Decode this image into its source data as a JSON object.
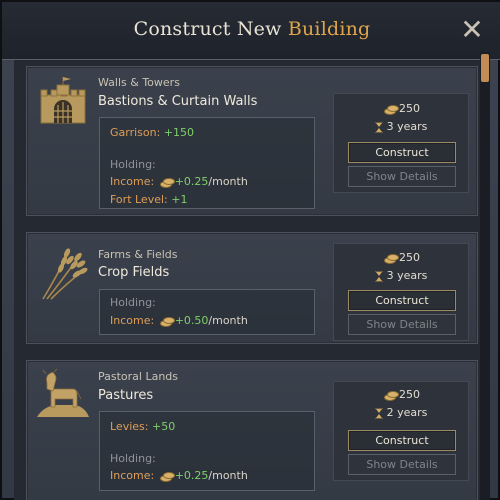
{
  "window": {
    "title_prefix": "Construct New ",
    "title_accent": "Building",
    "close_glyph": "✕"
  },
  "colors": {
    "accent": "#e0a54a",
    "positive": "#7fcf6b",
    "modifier_label": "#de9e58",
    "muted": "#8f939a"
  },
  "buildings": [
    {
      "category": "Walls & Towers",
      "name": "Bastions & Curtain Walls",
      "icon": "castle-gate-icon",
      "effects": {
        "garrison_label": "Garrison:",
        "garrison_value": "+150",
        "holding_label": "Holding:",
        "income_label": "Income:",
        "income_value": "+0.25",
        "income_unit": "/month",
        "fort_label": "Fort Level:",
        "fort_value": "+1"
      },
      "cost": "250",
      "time": "3 years",
      "construct_label": "Construct",
      "details_label": "Show Details"
    },
    {
      "category": "Farms & Fields",
      "name": "Crop Fields",
      "icon": "wheat-icon",
      "effects": {
        "holding_label": "Holding:",
        "income_label": "Income:",
        "income_value": "+0.50",
        "income_unit": "/month"
      },
      "cost": "250",
      "time": "3 years",
      "construct_label": "Construct",
      "details_label": "Show Details"
    },
    {
      "category": "Pastoral Lands",
      "name": "Pastures",
      "icon": "cow-icon",
      "effects": {
        "levies_label": "Levies:",
        "levies_value": "+50",
        "holding_label": "Holding:",
        "income_label": "Income:",
        "income_value": "+0.25",
        "income_unit": "/month"
      },
      "cost": "250",
      "time": "2 years",
      "construct_label": "Construct",
      "details_label": "Show Details"
    }
  ]
}
